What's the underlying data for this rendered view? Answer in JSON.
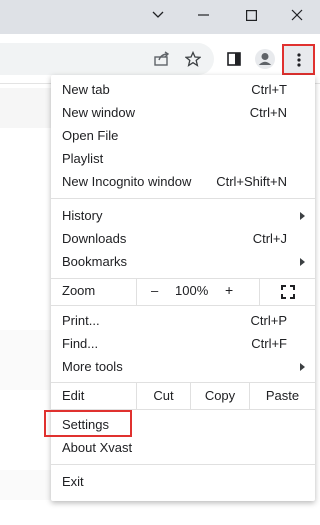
{
  "window": {
    "icons": [
      "chevron-down-icon",
      "minimize-icon",
      "maximize-icon",
      "close-icon"
    ]
  },
  "toolbar": {
    "icons": [
      "share-icon",
      "bookmark-star-icon",
      "side-panel-icon",
      "profile-icon",
      "kebab-menu-icon"
    ]
  },
  "menu": {
    "group1": [
      {
        "label": "New tab",
        "shortcut": "Ctrl+T"
      },
      {
        "label": "New window",
        "shortcut": "Ctrl+N"
      },
      {
        "label": "Open File",
        "shortcut": ""
      },
      {
        "label": "Playlist",
        "shortcut": ""
      },
      {
        "label": "New Incognito window",
        "shortcut": "Ctrl+Shift+N"
      }
    ],
    "group2": [
      {
        "label": "History",
        "shortcut": ""
      },
      {
        "label": "Downloads",
        "shortcut": "Ctrl+J"
      },
      {
        "label": "Bookmarks",
        "shortcut": ""
      }
    ],
    "zoom": {
      "label": "Zoom",
      "minus": "–",
      "value": "100%",
      "plus": "+"
    },
    "group3": [
      {
        "label": "Print...",
        "shortcut": "Ctrl+P"
      },
      {
        "label": "Find...",
        "shortcut": "Ctrl+F"
      },
      {
        "label": "More tools",
        "shortcut": ""
      }
    ],
    "edit": {
      "label": "Edit",
      "cut": "Cut",
      "copy": "Copy",
      "paste": "Paste"
    },
    "group4": [
      {
        "label": "Settings"
      },
      {
        "label": "About Xvast"
      }
    ],
    "exit": {
      "label": "Exit"
    }
  },
  "highlight_color": "#e0312f"
}
